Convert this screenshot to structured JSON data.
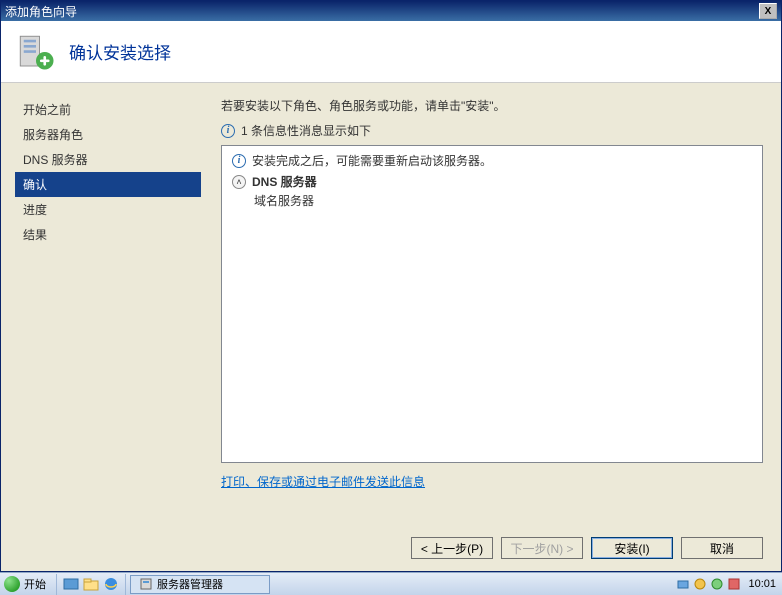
{
  "window": {
    "title": "添加角色向导",
    "close": "X"
  },
  "header": {
    "title": "确认安装选择"
  },
  "sidebar": {
    "items": [
      {
        "label": "开始之前"
      },
      {
        "label": "服务器角色"
      },
      {
        "label": "DNS 服务器"
      },
      {
        "label": "确认"
      },
      {
        "label": "进度"
      },
      {
        "label": "结果"
      }
    ]
  },
  "content": {
    "intro": "若要安装以下角色、角色服务或功能，请单击\"安装\"。",
    "info_count": "1 条信息性消息显示如下",
    "panel_msg": "安装完成之后，可能需要重新启动该服务器。",
    "role_title": "DNS 服务器",
    "role_desc": "域名服务器",
    "link": "打印、保存或通过电子邮件发送此信息"
  },
  "buttons": {
    "prev": "< 上一步(P)",
    "next": "下一步(N) >",
    "install": "安装(I)",
    "cancel": "取消"
  },
  "taskbar": {
    "start": "开始",
    "task1": "服务器管理器",
    "clock": "10:01"
  }
}
